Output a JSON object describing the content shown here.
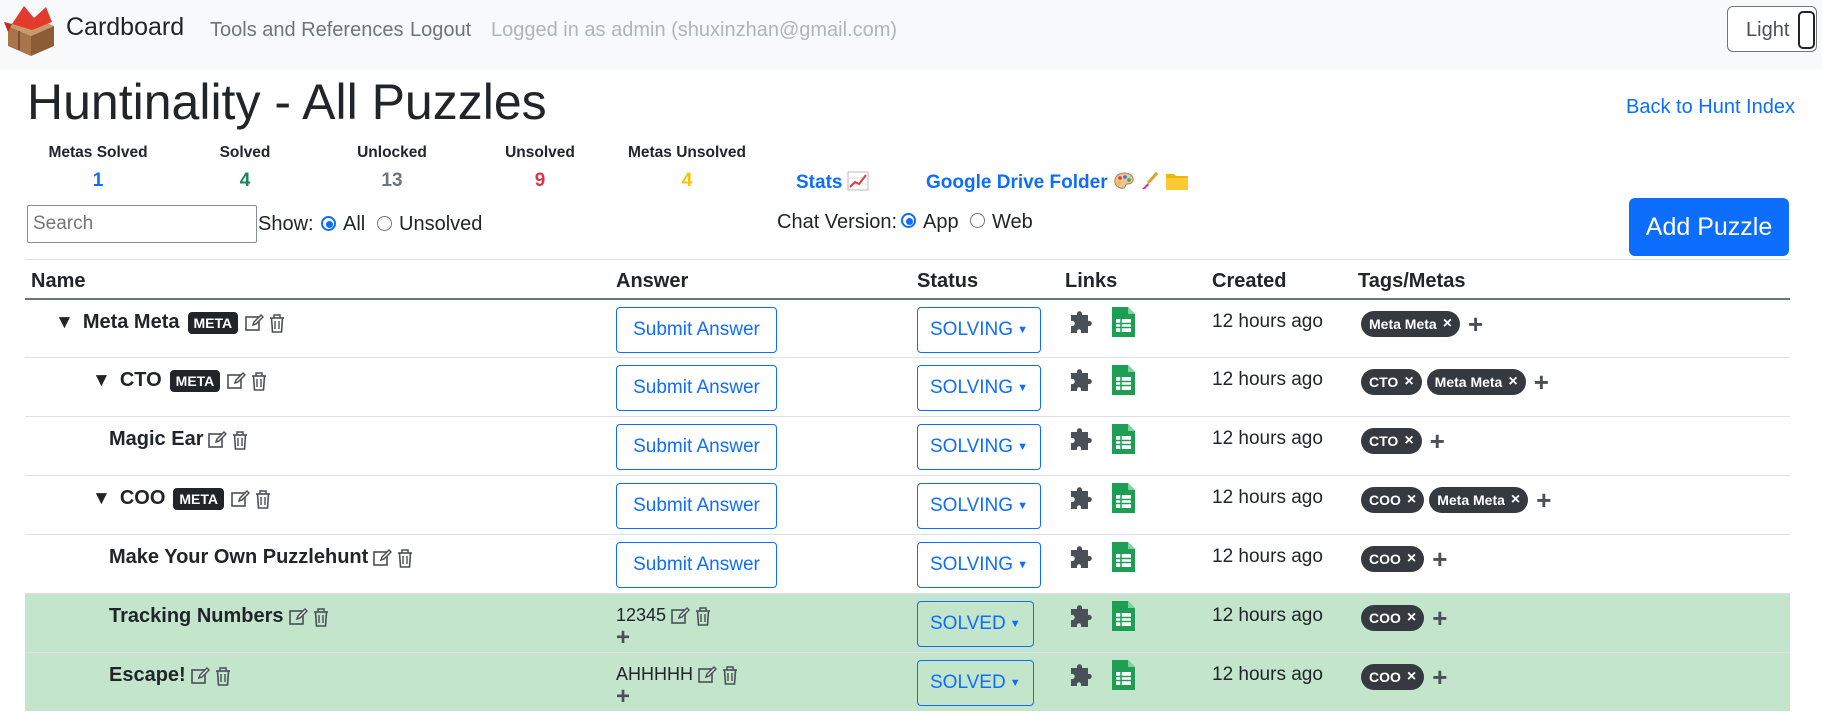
{
  "navbar": {
    "brand": "Cardboard",
    "links": [
      "Tools and References",
      "Logout"
    ],
    "logged_in_text": "Logged in as admin (shuxinzhan@gmail.com)",
    "theme_label": "Light"
  },
  "header": {
    "title": "Huntinality - All Puzzles",
    "back_link": "Back to Hunt Index"
  },
  "stats": [
    {
      "label": "Metas Solved",
      "value": "1",
      "color": "#0d6efd"
    },
    {
      "label": "Solved",
      "value": "4",
      "color": "#198754"
    },
    {
      "label": "Unlocked",
      "value": "13",
      "color": "#6c757d"
    },
    {
      "label": "Unsolved",
      "value": "9",
      "color": "#dc3545"
    },
    {
      "label": "Metas Unsolved",
      "value": "4",
      "color": "#ffc107"
    }
  ],
  "stats_link": {
    "label": "Stats",
    "icon": "chart-increasing-icon"
  },
  "drive_link": {
    "label": "Google Drive Folder",
    "icons": [
      "palette-icon",
      "paintbrush-icon",
      "folder-icon"
    ]
  },
  "filters": {
    "search_placeholder": "Search",
    "show_label": "Show:",
    "show_options": [
      "All",
      "Unsolved"
    ],
    "show_selected": "All",
    "chat_label": "Chat Version:",
    "chat_options": [
      "App",
      "Web"
    ],
    "chat_selected": "App",
    "add_puzzle": "Add Puzzle"
  },
  "table": {
    "headers": [
      "Name",
      "Answer",
      "Status",
      "Links",
      "Created",
      "Tags/Metas"
    ],
    "submit_label": "Submit Answer",
    "rows": [
      {
        "name": "Meta Meta",
        "meta": "META",
        "caret": "▼",
        "answer": "",
        "status": "SOLVING",
        "created": "12 hours ago",
        "tags": [
          "Meta Meta"
        ],
        "solved": false
      },
      {
        "name": "CTO",
        "meta": "META",
        "caret": "▼",
        "answer": "",
        "status": "SOLVING",
        "created": "12 hours ago",
        "tags": [
          "CTO",
          "Meta Meta"
        ],
        "solved": false
      },
      {
        "name": "Magic Ear",
        "meta": "",
        "caret": "",
        "answer": "",
        "status": "SOLVING",
        "created": "12 hours ago",
        "tags": [
          "CTO"
        ],
        "solved": false
      },
      {
        "name": "COO",
        "meta": "META",
        "caret": "▼",
        "answer": "",
        "status": "SOLVING",
        "created": "12 hours ago",
        "tags": [
          "COO",
          "Meta Meta"
        ],
        "solved": false
      },
      {
        "name": "Make Your Own Puzzlehunt",
        "meta": "",
        "caret": "",
        "answer": "",
        "status": "SOLVING",
        "created": "12 hours ago",
        "tags": [
          "COO"
        ],
        "solved": false
      },
      {
        "name": "Tracking Numbers",
        "meta": "",
        "caret": "",
        "answer": "12345",
        "status": "SOLVED",
        "created": "12 hours ago",
        "tags": [
          "COO"
        ],
        "solved": true
      },
      {
        "name": "Escape!",
        "meta": "",
        "caret": "",
        "answer": "AHHHHH",
        "status": "SOLVED",
        "created": "12 hours ago",
        "tags": [
          "COO"
        ],
        "solved": true
      }
    ]
  }
}
